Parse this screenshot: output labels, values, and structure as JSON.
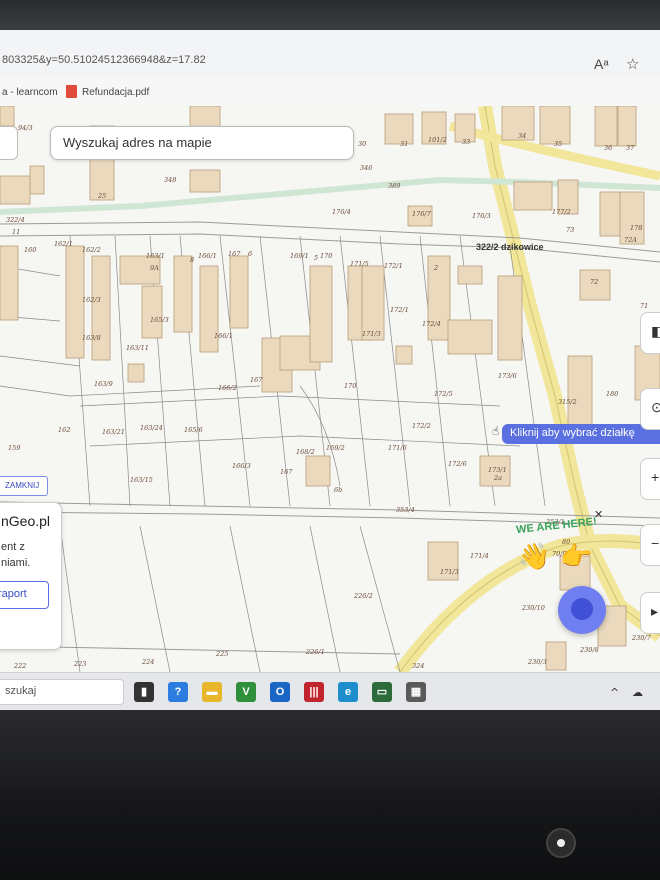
{
  "browser": {
    "url_fragment": "803325&y=50.51024512366948&z=17.82",
    "reader_mode_label": "A",
    "bookmarks": [
      {
        "label": "a - learncom"
      },
      {
        "label": "Refundacja.pdf"
      }
    ]
  },
  "map": {
    "search_placeholder": "Wyszukaj adres na mapie",
    "street_label": "322/2 dzikowice",
    "tooltip": "Kliknij aby wybrać działkę",
    "close_label": "ZAMKNIJ",
    "panel": {
      "title": "nGeo.pl",
      "line1": "ent z",
      "line2": "niami.",
      "report_button": "raport"
    },
    "promo_text": "WE ARE HERE!",
    "zoom_in_label": "+",
    "zoom_out_label": "−",
    "parcels": [
      {
        "id": "94/3"
      },
      {
        "id": "322/4"
      },
      {
        "id": "11"
      },
      {
        "id": "160"
      },
      {
        "id": "162/1"
      },
      {
        "id": "162/2"
      },
      {
        "id": "163/1"
      },
      {
        "id": "9A"
      },
      {
        "id": "8"
      },
      {
        "id": "166/1"
      },
      {
        "id": "167"
      },
      {
        "id": "6"
      },
      {
        "id": "169/1"
      },
      {
        "id": "5"
      },
      {
        "id": "170"
      },
      {
        "id": "171/5"
      },
      {
        "id": "172/1"
      },
      {
        "id": "2"
      },
      {
        "id": "30"
      },
      {
        "id": "31"
      },
      {
        "id": "101/2"
      },
      {
        "id": "33"
      },
      {
        "id": "34"
      },
      {
        "id": "35"
      },
      {
        "id": "36"
      },
      {
        "id": "37"
      },
      {
        "id": "346"
      },
      {
        "id": "348"
      },
      {
        "id": "25"
      },
      {
        "id": "176/4"
      },
      {
        "id": "176/7"
      },
      {
        "id": "176/3"
      },
      {
        "id": "177/2"
      },
      {
        "id": "73"
      },
      {
        "id": "178"
      },
      {
        "id": "72A"
      },
      {
        "id": "72"
      },
      {
        "id": "389"
      },
      {
        "id": "162/3"
      },
      {
        "id": "165/3"
      },
      {
        "id": "163/8"
      },
      {
        "id": "163/11"
      },
      {
        "id": "166/1"
      },
      {
        "id": "171/3"
      },
      {
        "id": "172/1"
      },
      {
        "id": "172/4"
      },
      {
        "id": "163/9"
      },
      {
        "id": "166/2"
      },
      {
        "id": "167"
      },
      {
        "id": "170"
      },
      {
        "id": "173/6"
      },
      {
        "id": "172/5"
      },
      {
        "id": "180"
      },
      {
        "id": "315/2"
      },
      {
        "id": "159"
      },
      {
        "id": "162"
      },
      {
        "id": "163/21"
      },
      {
        "id": "163/24"
      },
      {
        "id": "165/6"
      },
      {
        "id": "172/2"
      },
      {
        "id": "168/2"
      },
      {
        "id": "169/2"
      },
      {
        "id": "171/6"
      },
      {
        "id": "166/3"
      },
      {
        "id": "167"
      },
      {
        "id": "172/6"
      },
      {
        "id": "173/1"
      },
      {
        "id": "2a"
      },
      {
        "id": "163/15"
      },
      {
        "id": "6b"
      },
      {
        "id": "353/4"
      },
      {
        "id": "353/1"
      },
      {
        "id": "80"
      },
      {
        "id": "171/4"
      },
      {
        "id": "171/3"
      },
      {
        "id": "226/2"
      },
      {
        "id": "230/10"
      },
      {
        "id": "222"
      },
      {
        "id": "223"
      },
      {
        "id": "224"
      },
      {
        "id": "225"
      },
      {
        "id": "226/1"
      },
      {
        "id": "324"
      },
      {
        "id": "230/3"
      },
      {
        "id": "230/8"
      },
      {
        "id": "230/7"
      },
      {
        "id": "71"
      },
      {
        "id": "70/9"
      }
    ]
  },
  "taskbar": {
    "search_label": "szukaj",
    "apps": [
      {
        "name": "task-view",
        "color": "#333333",
        "glyph": "▮"
      },
      {
        "name": "help",
        "color": "#2d7de0",
        "glyph": "?"
      },
      {
        "name": "file-explorer",
        "color": "#e8b62a",
        "glyph": "▬"
      },
      {
        "name": "vlc-app",
        "color": "#2f8f3a",
        "glyph": "V"
      },
      {
        "name": "outlook",
        "color": "#1a66c4",
        "glyph": "O"
      },
      {
        "name": "barcode-app",
        "color": "#c0242c",
        "glyph": "|||"
      },
      {
        "name": "edge",
        "color": "#1d8fcf",
        "glyph": "e"
      },
      {
        "name": "terminal-app",
        "color": "#2e6b3a",
        "glyph": "▭"
      },
      {
        "name": "calculator",
        "color": "#5a5a5a",
        "glyph": "▦"
      }
    ],
    "tray": [
      "^",
      "☁"
    ]
  }
}
